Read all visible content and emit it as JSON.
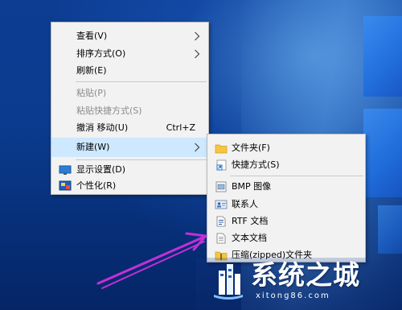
{
  "context_menu": {
    "items": [
      {
        "label": "查看(V)",
        "has_submenu": true
      },
      {
        "label": "排序方式(O)",
        "has_submenu": true
      },
      {
        "label": "刷新(E)"
      },
      {
        "label": "粘贴(P)",
        "disabled": true
      },
      {
        "label": "粘贴快捷方式(S)",
        "disabled": true
      },
      {
        "label": "撤消 移动(U)",
        "shortcut": "Ctrl+Z"
      },
      {
        "label": "新建(W)",
        "has_submenu": true,
        "highlighted": true
      },
      {
        "label": "显示设置(D)",
        "icon": "display-settings-icon"
      },
      {
        "label": "个性化(R)",
        "icon": "personalize-icon"
      }
    ]
  },
  "new_submenu": {
    "items": [
      {
        "label": "文件夹(F)",
        "icon": "folder-icon"
      },
      {
        "label": "快捷方式(S)",
        "icon": "shortcut-icon"
      },
      {
        "label": "BMP 图像",
        "icon": "bmp-image-icon"
      },
      {
        "label": "联系人",
        "icon": "contact-icon"
      },
      {
        "label": "RTF 文档",
        "icon": "rtf-document-icon"
      },
      {
        "label": "文本文档",
        "icon": "text-document-icon"
      },
      {
        "label": "压缩(zipped)文件夹",
        "icon": "zip-folder-icon"
      }
    ]
  },
  "annotation": {
    "arrow_color": "#c030d8"
  },
  "watermark": {
    "title": "系统之城",
    "url": "xitong86.com"
  },
  "colors": {
    "menu_bg": "#f2f2f2",
    "highlight": "#cde8ff",
    "desktop": "#0b3b8e"
  }
}
